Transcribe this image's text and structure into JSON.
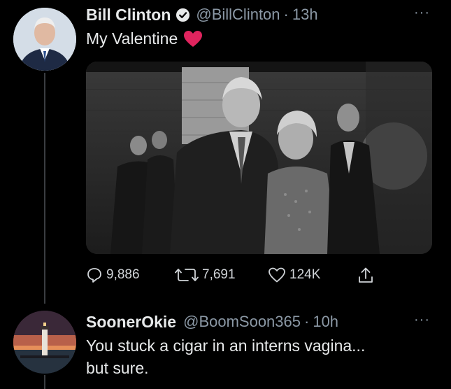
{
  "tweet1": {
    "display_name": "Bill Clinton",
    "handle": "@BillClinton",
    "separator": "·",
    "time": "13h",
    "text": "My Valentine",
    "emoji": "heart-emoji",
    "more_label": "···",
    "replies": "9,886",
    "retweets": "7,691",
    "likes": "124K"
  },
  "tweet2": {
    "display_name": "SoonerOkie",
    "handle": "@BoomSoon365",
    "separator": "·",
    "time": "10h",
    "text_line1": "You stuck a cigar in an interns vagina...",
    "text_line2": "but sure.",
    "more_label": "···"
  },
  "colors": {
    "background": "#000000",
    "text_primary": "#e7e9ea",
    "text_secondary": "#8b98a5",
    "heart": "#e0245e",
    "thread_line": "#3a3d41"
  }
}
